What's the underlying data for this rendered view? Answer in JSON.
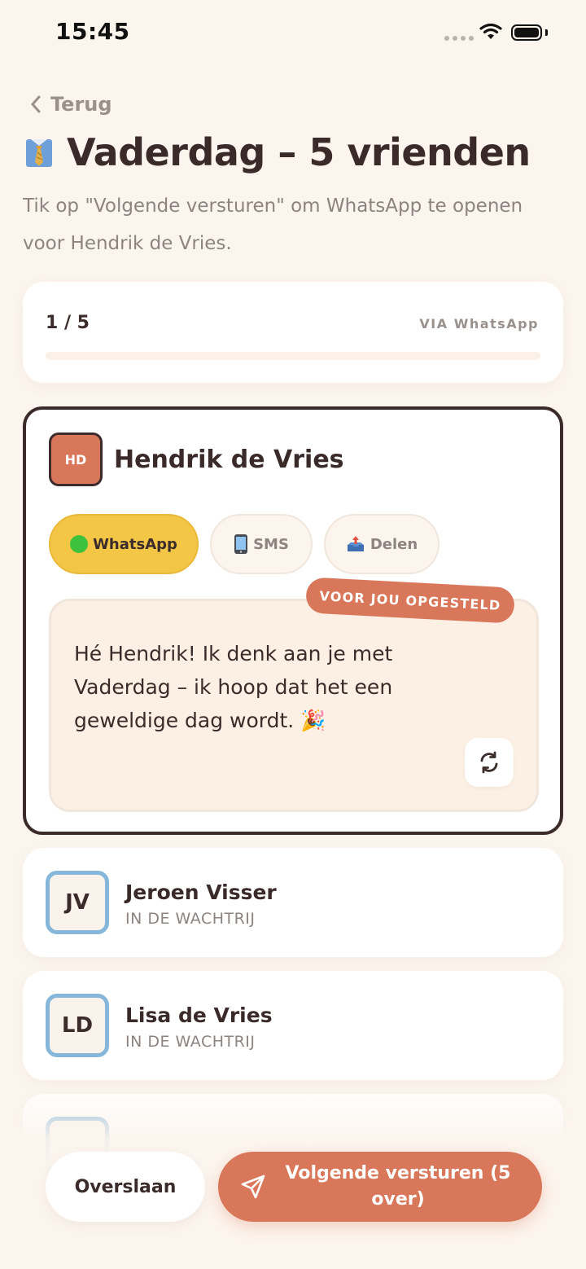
{
  "status_bar": {
    "time": "15:45"
  },
  "header": {
    "back_label": "Terug",
    "title": "Vaderdag – 5 vrienden",
    "subtitle": "Tik op \"Volgende versturen\" om WhatsApp te openen voor Hendrik de Vries."
  },
  "progress": {
    "count": "1 / 5",
    "channel": "VIA WhatsApp",
    "fraction": 0.0
  },
  "active_contact": {
    "initials": "HD",
    "name": "Hendrik de Vries",
    "channels": [
      {
        "label": "WhatsApp",
        "icon": "green-circle-icon",
        "selected": true
      },
      {
        "label": "SMS",
        "icon": "mobile-phone-icon",
        "selected": false
      },
      {
        "label": "Delen",
        "icon": "share-tray-icon",
        "selected": false
      }
    ],
    "badge": "VOOR JOU OPGESTELD",
    "message": "Hé Hendrik! Ik denk aan je met Vaderdag – ik hoop dat het een geweldige dag wordt. 🎉"
  },
  "queue": [
    {
      "initials": "JV",
      "name": "Jeroen Visser",
      "status": "IN DE WACHTRIJ"
    },
    {
      "initials": "LD",
      "name": "Lisa de Vries",
      "status": "IN DE WACHTRIJ"
    }
  ],
  "actions": {
    "skip_label": "Overslaan",
    "send_label": "Volgende versturen (5 over)"
  },
  "colors": {
    "background": "#fcf5ee",
    "accent": "#d9775a",
    "selected_chip": "#f3c646",
    "avatar_border": "#86b7da",
    "text_dark": "#3b2b2a"
  }
}
